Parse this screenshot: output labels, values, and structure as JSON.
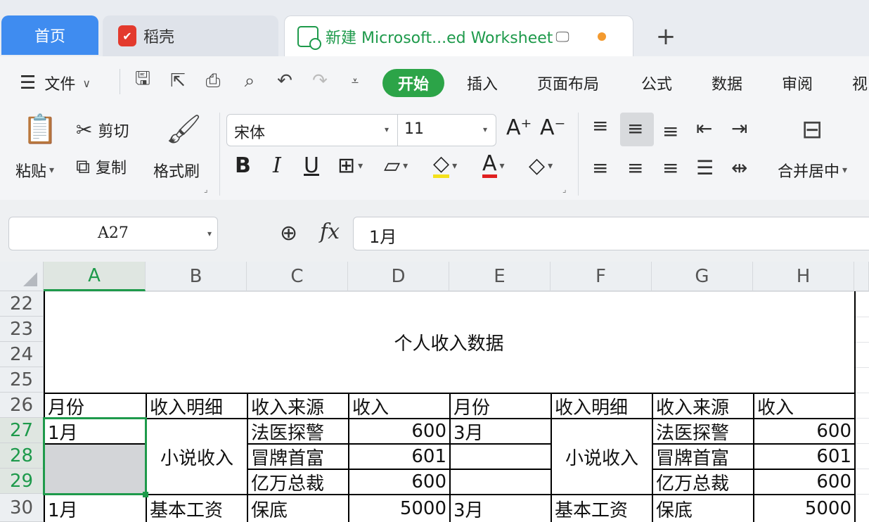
{
  "tabs": {
    "home": "首页",
    "daoke": "稻壳",
    "doc": "新建 Microsoft...ed Worksheet",
    "add": "+"
  },
  "menu": {
    "file": "文件",
    "items": [
      "开始",
      "插入",
      "页面布局",
      "公式",
      "数据",
      "审阅",
      "视"
    ]
  },
  "ribbon": {
    "paste": "粘贴",
    "cut": "剪切",
    "copy": "复制",
    "format_painter": "格式刷",
    "font_name": "宋体",
    "font_size": "11",
    "merge_center": "合并居中"
  },
  "formula_bar": {
    "name_box": "A27",
    "fx": "fx",
    "value": "1月"
  },
  "grid": {
    "columns": [
      "A",
      "B",
      "C",
      "D",
      "E",
      "F",
      "G",
      "H"
    ],
    "rows": [
      "22",
      "23",
      "24",
      "25",
      "26",
      "27",
      "28",
      "29",
      "30"
    ],
    "title": "个人收入数据",
    "header": [
      "月份",
      "收入明细",
      "收入来源",
      "收入",
      "月份",
      "收入明细",
      "收入来源",
      "收入"
    ],
    "r27": {
      "a": "1月",
      "c": "法医探警",
      "d": "600",
      "e": "3月",
      "g": "法医探警",
      "h": "600"
    },
    "r28": {
      "c": "冒牌首富",
      "d": "601",
      "g": "冒牌首富",
      "h": "601"
    },
    "r29": {
      "c": "亿万总裁",
      "d": "600",
      "g": "亿万总裁",
      "h": "600"
    },
    "merged_b": "小说收入",
    "merged_f": "小说收入",
    "r30": {
      "a": "1月",
      "b": "基本工资",
      "c": "保底",
      "d": "5000",
      "e": "3月",
      "f": "基本工资",
      "g": "保底",
      "h": "5000"
    }
  },
  "colors": {
    "accent_green": "#1e9a4b",
    "tab_blue": "#3f8cf0",
    "start_green": "#2ca448"
  }
}
